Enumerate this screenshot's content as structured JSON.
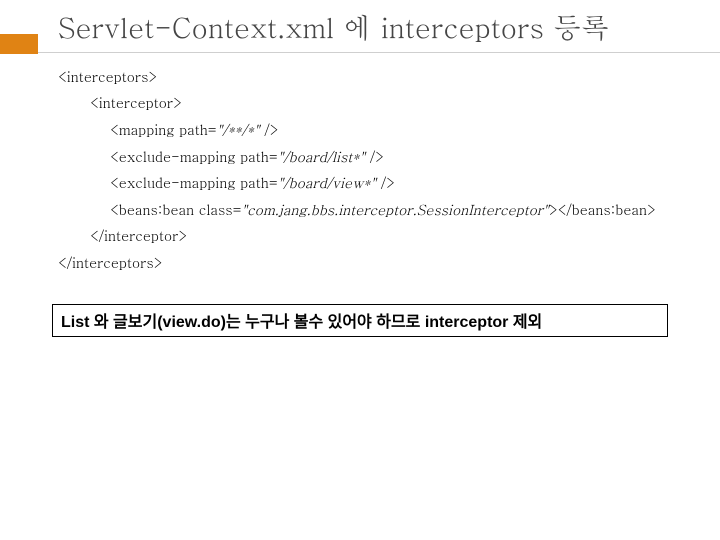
{
  "title": "Servlet-Context.xml 에 interceptors 등록",
  "code": {
    "l0": "<interceptors>",
    "l1": "<interceptor>",
    "l2_a": "<mapping path=",
    "l2_b": "\"/**/*\" ",
    "l2_c": "/>",
    "l3_a": "<exclude-mapping path=",
    "l3_b": "\"/board/list*\" ",
    "l3_c": "/>",
    "l4_a": "<exclude-mapping path=",
    "l4_b": "\"/board/view*\" ",
    "l4_c": "/>",
    "l5_a": "<beans:bean class=",
    "l5_b": "\"com.jang.bbs.interceptor.SessionInterceptor\"",
    "l5_c": "></beans:bean>",
    "l6": "</interceptor>",
    "l7": "</interceptors>"
  },
  "note": "List 와  글보기(view.do)는   누구나 볼수 있어야 하므로 interceptor 제외"
}
